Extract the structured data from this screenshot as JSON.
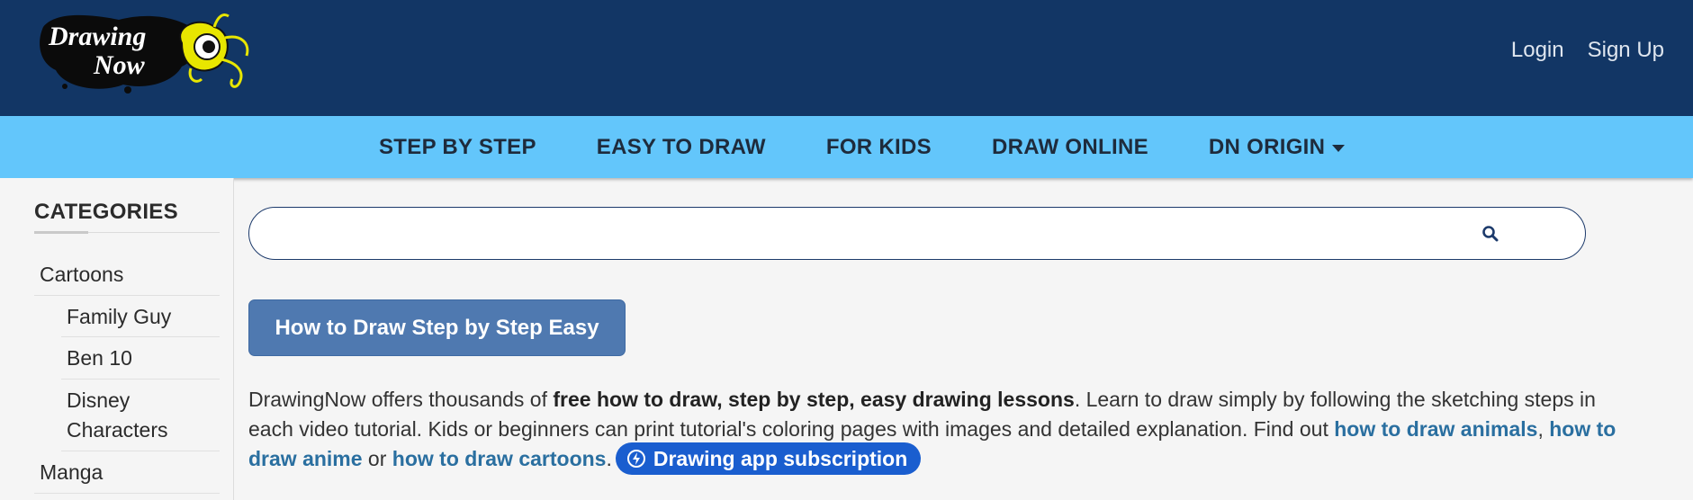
{
  "header": {
    "logo_text_line1": "Drawing",
    "logo_text_line2": "Now",
    "auth": {
      "login": "Login",
      "signup": "Sign Up"
    }
  },
  "nav": {
    "items": [
      "STEP BY STEP",
      "EASY TO DRAW",
      "FOR KIDS",
      "DRAW ONLINE",
      "DN ORIGIN"
    ]
  },
  "sidebar": {
    "title": "CATEGORIES",
    "items": [
      {
        "label": "Cartoons",
        "level": 0
      },
      {
        "label": "Family Guy",
        "level": 1
      },
      {
        "label": "Ben 10",
        "level": 1
      },
      {
        "label": "Disney",
        "label2": "Characters",
        "level": 1
      },
      {
        "label": "Manga",
        "level": 0
      }
    ]
  },
  "search": {
    "placeholder": "",
    "icon": "search-icon"
  },
  "main": {
    "primary_button": "How to Draw Step by Step Easy",
    "description": {
      "part1": "DrawingNow offers thousands of ",
      "bold": "free how to draw, step by step, easy drawing lessons",
      "part2": ". Learn to draw simply by following the sketching steps in each video tutorial. Kids or beginners can print tutorial's coloring pages with images and detailed explanation. Find out ",
      "link_animals": "how to draw animals",
      "sep1": ", ",
      "link_anime": "how to draw anime",
      "sep2": " or ",
      "link_cartoons": "how to draw cartoons",
      "end": "."
    },
    "subscription_button": "Drawing app subscription"
  },
  "colors": {
    "header_bg": "#123665",
    "nav_bg": "#63c6fb",
    "primary_button": "#4f79b0",
    "link": "#2a6fa0",
    "subscription": "#1a5ecf"
  }
}
